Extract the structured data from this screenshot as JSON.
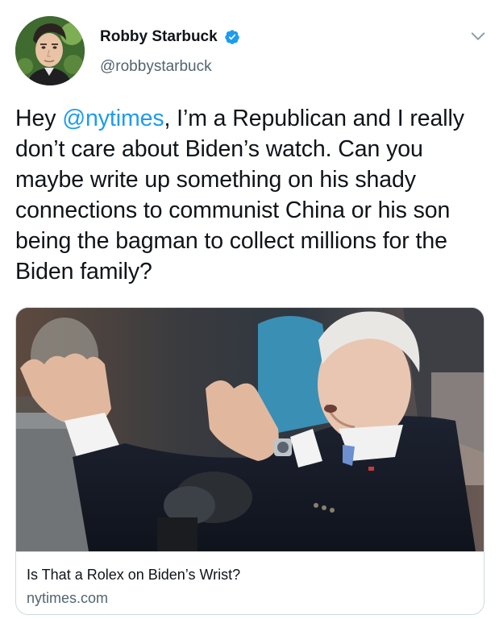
{
  "tweet": {
    "author": {
      "display_name": "Robby Starbuck",
      "handle": "@robbystarbuck",
      "verified": true,
      "avatar_icon": "profile-photo"
    },
    "text": {
      "prefix": "Hey ",
      "mention": "@nytimes",
      "body": ", I’m a Republican and I really don’t care about Biden’s watch. Can you maybe write up something on his shady connections to communist China or his son being the bagman to collect millions for the Biden family?"
    },
    "card": {
      "title": "Is That a Rolex on Biden’s Wrist?",
      "domain": "nytimes.com"
    },
    "colors": {
      "link": "#1d9bf0",
      "verified_badge": "#1d9bf0",
      "secondary_text": "#536471",
      "border": "#cfd9de"
    }
  }
}
